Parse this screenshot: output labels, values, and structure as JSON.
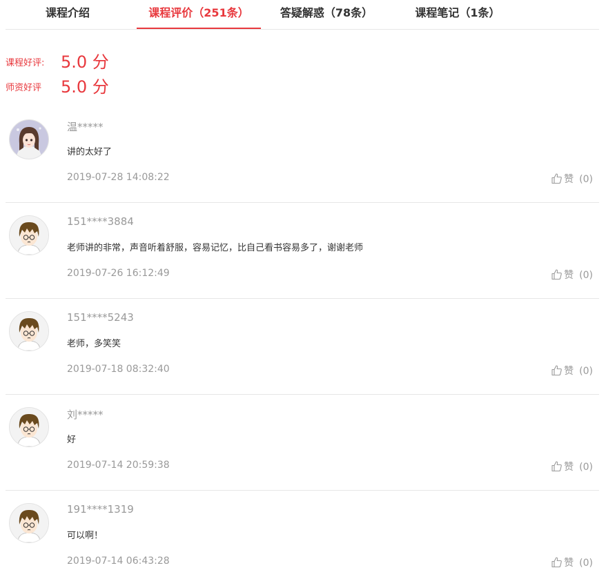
{
  "tabs": [
    {
      "label": "课程介绍",
      "active": false
    },
    {
      "label": "课程评价（251条）",
      "active": true
    },
    {
      "label": "答疑解惑（78条）",
      "active": false
    },
    {
      "label": "课程笔记（1条）",
      "active": false
    }
  ],
  "scores": {
    "course": {
      "label": "课程好评:",
      "value": "5.0 分"
    },
    "teacher": {
      "label": "师资好评",
      "value": "5.0 分"
    }
  },
  "colors": {
    "accent": "#e8383d",
    "muted_text": "#999999",
    "divider": "#e6e6e6"
  },
  "reviews": [
    {
      "avatar": "girl-avatar",
      "user": "温*****",
      "content": "讲的太好了",
      "time": "2019-07-28 14:08:22",
      "like_label": "赞",
      "likes": "(0)"
    },
    {
      "avatar": "boy-avatar",
      "user": "151****3884",
      "content": "老师讲的非常，声音听着舒服，容易记忆，比自己看书容易多了，谢谢老师",
      "time": "2019-07-26 16:12:49",
      "like_label": "赞",
      "likes": "(0)"
    },
    {
      "avatar": "boy-avatar",
      "user": "151****5243",
      "content": "老师，多笑笑",
      "time": "2019-07-18 08:32:40",
      "like_label": "赞",
      "likes": "(0)"
    },
    {
      "avatar": "boy-avatar",
      "user": "刘*****",
      "content": "好",
      "time": "2019-07-14 20:59:38",
      "like_label": "赞",
      "likes": "(0)"
    },
    {
      "avatar": "boy-avatar",
      "user": "191****1319",
      "content": "可以啊！",
      "time": "2019-07-14 06:43:28",
      "like_label": "赞",
      "likes": "(0)"
    }
  ]
}
